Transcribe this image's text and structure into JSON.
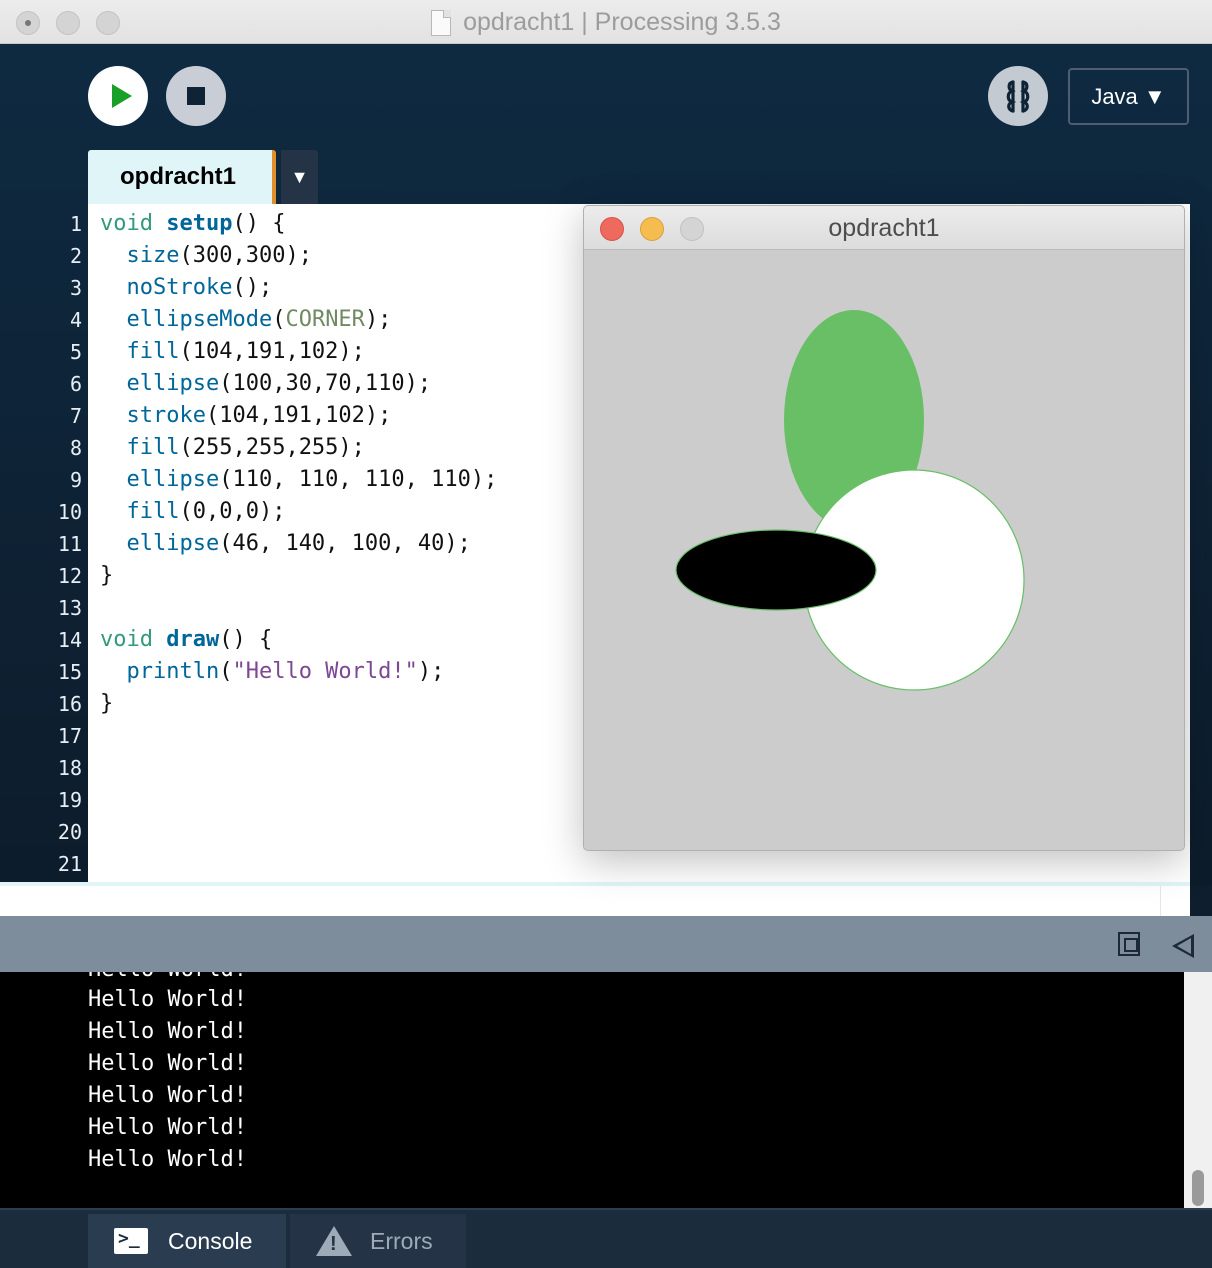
{
  "window": {
    "title": "opdracht1 | Processing 3.5.3"
  },
  "toolbar": {
    "mode_label": "Java ▼"
  },
  "tabs": [
    {
      "label": "opdracht1"
    }
  ],
  "tab_menu_glyph": "▼",
  "editor": {
    "line_numbers": [
      "1",
      "2",
      "3",
      "4",
      "5",
      "6",
      "7",
      "8",
      "9",
      "10",
      "11",
      "12",
      "13",
      "14",
      "15",
      "16",
      "17",
      "18",
      "19",
      "20",
      "21"
    ],
    "code": [
      "void setup() {",
      "  size(300,300);",
      "  noStroke();",
      "  ellipseMode(CORNER);",
      "  fill(104,191,102);",
      "  ellipse(100,30,70,110);",
      "  stroke(104,191,102);",
      "  fill(255,255,255);",
      "  ellipse(110, 110, 110, 110);",
      "  fill(0,0,0);",
      "  ellipse(46, 140, 100, 40);",
      "}",
      "",
      "void draw() {",
      "  println(\"Hello World!\");",
      "}"
    ]
  },
  "sketch_window": {
    "title": "opdracht1",
    "background": "#cccccc",
    "green": "#68bf66"
  },
  "console": {
    "partial_line": "Hello World!",
    "lines": [
      "Hello World!",
      "Hello World!",
      "Hello World!",
      "Hello World!",
      "Hello World!",
      "Hello World!"
    ]
  },
  "footer": {
    "console_label": "Console",
    "errors_label": "Errors"
  },
  "colors": {
    "run_green": "#18a02a",
    "tab_bg": "#dff5f7",
    "tab_accent": "#e08f2a"
  }
}
